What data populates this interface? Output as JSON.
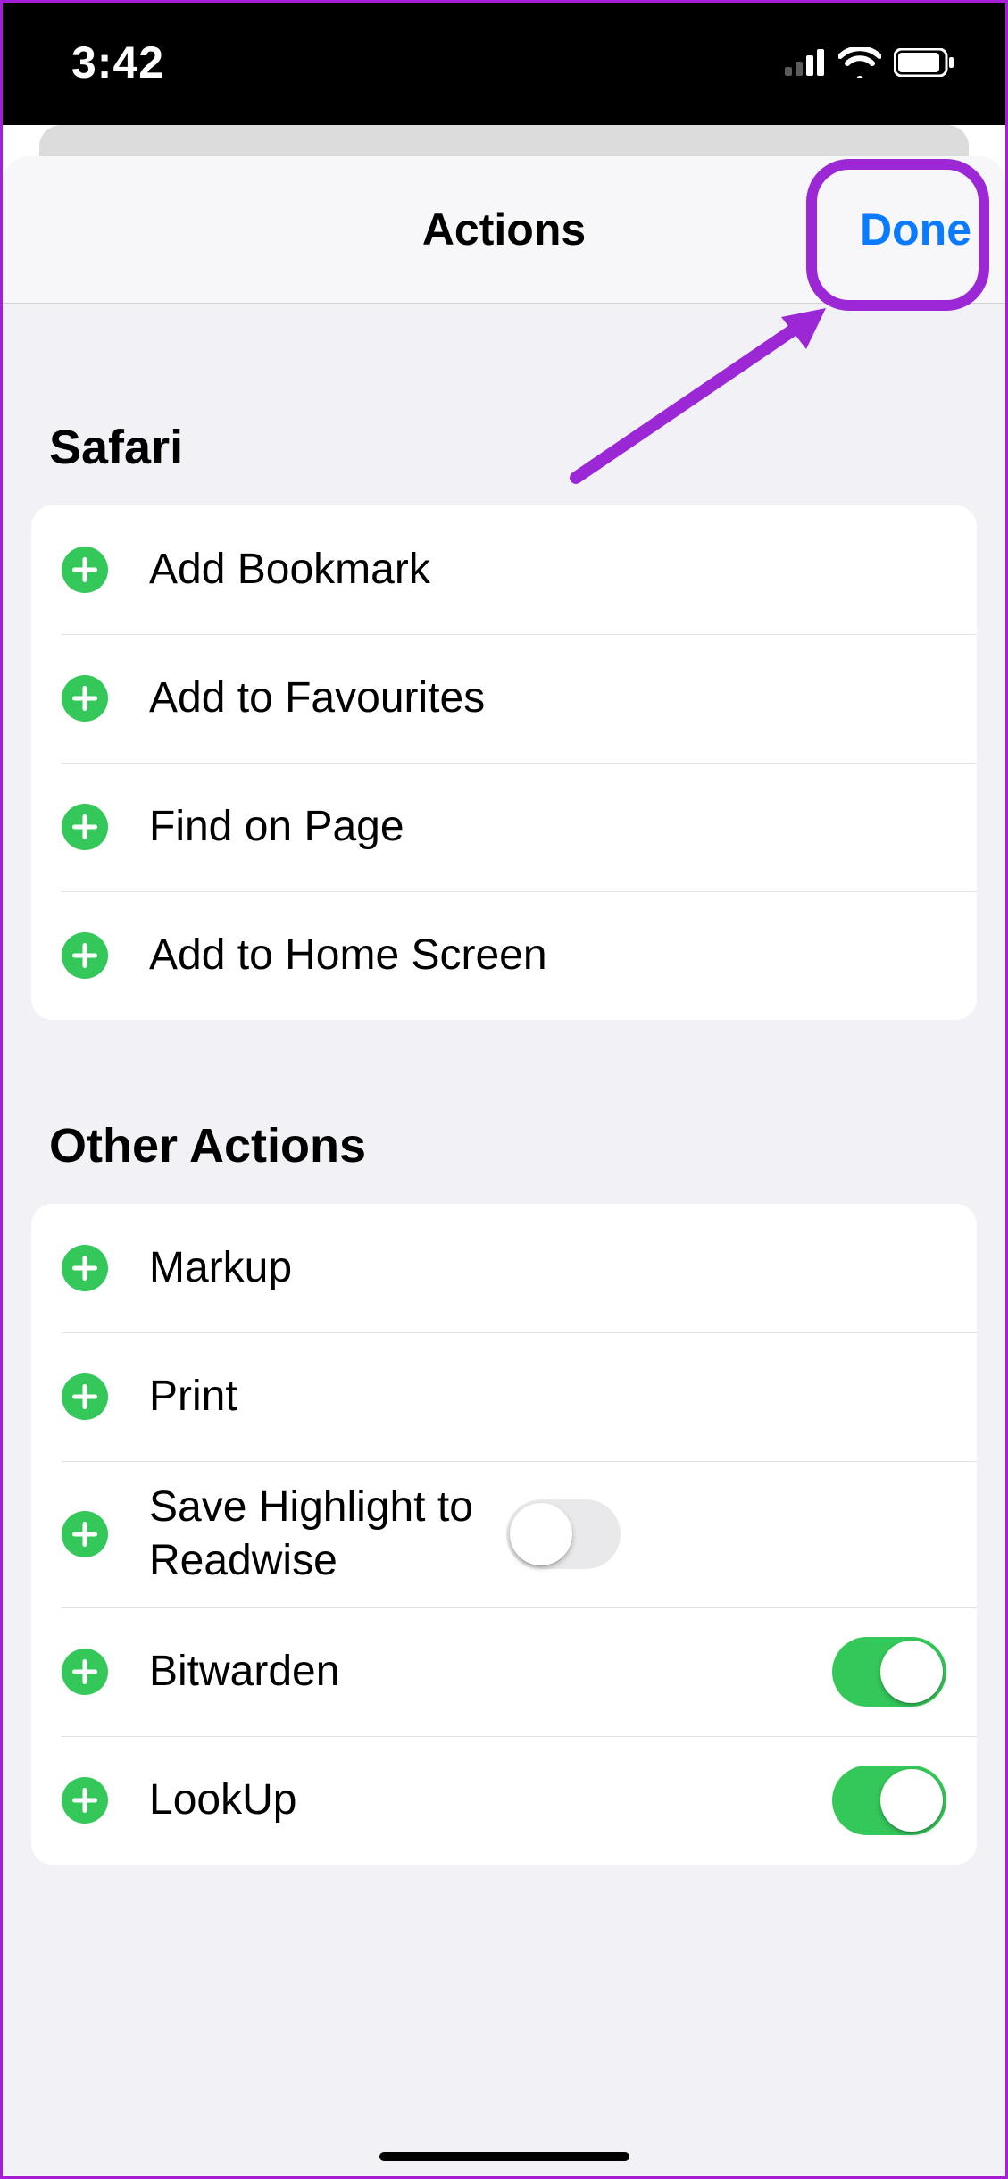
{
  "statusbar": {
    "time": "3:42"
  },
  "sheet": {
    "title": "Actions",
    "done_label": "Done"
  },
  "sections": {
    "safari": {
      "title": "Safari",
      "items": [
        {
          "label": "Add Bookmark"
        },
        {
          "label": "Add to Favourites"
        },
        {
          "label": "Find on Page"
        },
        {
          "label": "Add to Home Screen"
        }
      ]
    },
    "other": {
      "title": "Other Actions",
      "items": [
        {
          "label": "Markup",
          "has_toggle": false
        },
        {
          "label": "Print",
          "has_toggle": false
        },
        {
          "label": "Save Highlight to Readwise",
          "has_toggle": true,
          "toggle_on": false
        },
        {
          "label": "Bitwarden",
          "has_toggle": true,
          "toggle_on": true
        },
        {
          "label": "LookUp",
          "has_toggle": true,
          "toggle_on": true
        }
      ]
    }
  },
  "colors": {
    "accent_green": "#34c759",
    "accent_blue": "#0a7aff",
    "annotation_purple": "#9c27d4"
  }
}
